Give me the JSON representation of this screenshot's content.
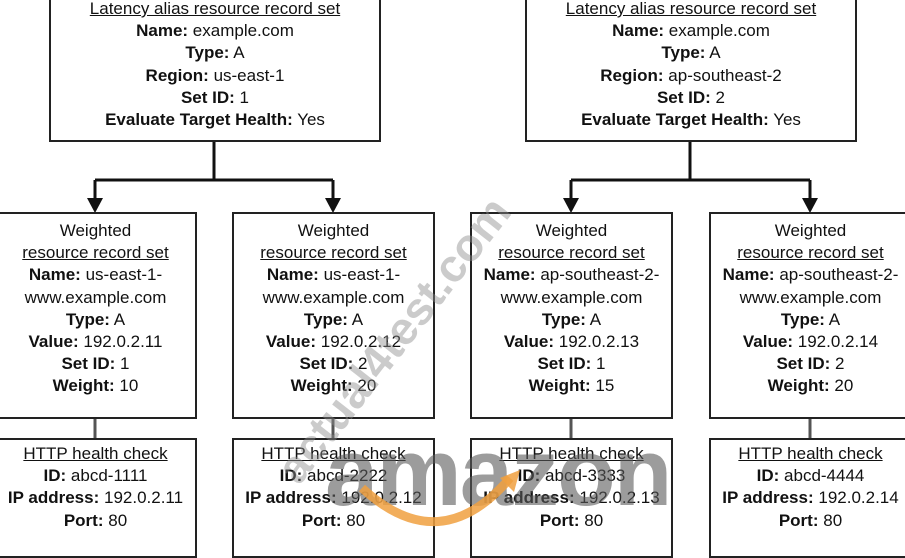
{
  "latency_sets": [
    {
      "title": "Latency alias resource record set",
      "name": "example.com",
      "type": "A",
      "region": "us-east-1",
      "set_id": "1",
      "evaluate": "Yes"
    },
    {
      "title": "Latency alias resource record set",
      "name": "example.com",
      "type": "A",
      "region": "ap-southeast-2",
      "set_id": "2",
      "evaluate": "Yes"
    }
  ],
  "labels": {
    "name": "Name:",
    "type": "Type:",
    "region": "Region:",
    "set_id": "Set ID:",
    "evaluate": "Evaluate Target Health:",
    "value": "Value:",
    "weight": "Weight:",
    "id": "ID:",
    "ip": "IP address:",
    "port": "Port:"
  },
  "weighted_sets": [
    {
      "title1": "Weighted",
      "title2": "resource record set",
      "name1": "us-east-1-",
      "name2": "www.example.com",
      "type": "A",
      "value": "192.0.2.11",
      "set_id": "1",
      "weight": "10"
    },
    {
      "title1": "Weighted",
      "title2": "resource record set",
      "name1": "us-east-1-",
      "name2": "www.example.com",
      "type": "A",
      "value": "192.0.2.12",
      "set_id": "2",
      "weight": "20"
    },
    {
      "title1": "Weighted",
      "title2": "resource record set",
      "name1": "ap-southeast-2-",
      "name2": "www.example.com",
      "type": "A",
      "value": "192.0.2.13",
      "set_id": "1",
      "weight": "15"
    },
    {
      "title1": "Weighted",
      "title2": "resource record set",
      "name1": "ap-southeast-2-",
      "name2": "www.example.com",
      "type": "A",
      "value": "192.0.2.14",
      "set_id": "2",
      "weight": "20"
    }
  ],
  "health_checks": [
    {
      "title": "HTTP health check",
      "id": "abcd-1111",
      "ip": "192.0.2.11",
      "port": "80"
    },
    {
      "title": "HTTP health check",
      "id": "abcd-2222",
      "ip": "192.0.2.12",
      "port": "80"
    },
    {
      "title": "HTTP health check",
      "id": "abcd-3333",
      "ip": "192.0.2.13",
      "port": "80"
    },
    {
      "title": "HTTP health check",
      "id": "abcd-4444",
      "ip": "192.0.2.14",
      "port": "80"
    }
  ],
  "watermark": {
    "site": "actual4test.com",
    "logo": "amazon",
    "logo_arrow_color": "#f0a040"
  }
}
